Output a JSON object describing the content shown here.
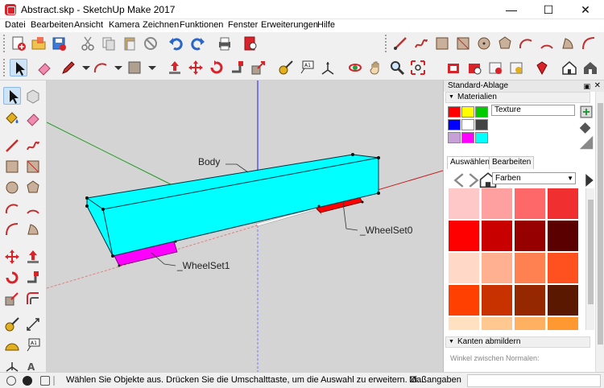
{
  "window": {
    "title": "Abstract.skp - SketchUp Make 2017",
    "controls": {
      "minimize": "—",
      "maximize": "☐",
      "close": "✕"
    }
  },
  "menu": [
    {
      "label": "Datei"
    },
    {
      "label": "Bearbeiten"
    },
    {
      "label": "Ansicht"
    },
    {
      "label": "Kamera"
    },
    {
      "label": "Zeichnen"
    },
    {
      "label": "Funktionen"
    },
    {
      "label": "Fenster"
    },
    {
      "label": "Erweiterungen"
    },
    {
      "label": "Hilfe"
    }
  ],
  "toolbar_icons": [
    "new-model-icon",
    "open-folder-icon",
    "save-icon",
    "cut-icon",
    "copy-icon",
    "paste-icon",
    "erase-icon",
    "undo-icon",
    "redo-icon",
    "print-icon",
    "model-info-icon",
    "line-icon",
    "freehand-icon",
    "rectangle-icon",
    "rotated-rectangle-icon",
    "circle-icon",
    "polygon-icon",
    "arc-icon",
    "pie-icon",
    "select-icon",
    "eraser-icon",
    "pencil-icon",
    "arc-tool-icon",
    "shape-icon",
    "push-pull-icon",
    "move-icon",
    "rotate-icon",
    "follow-me-icon",
    "scale-icon",
    "offset-icon",
    "tape-measure-icon",
    "text-icon",
    "axes-icon",
    "dimension-icon",
    "orbit-icon",
    "pan-icon",
    "zoom-icon",
    "zoom-extents-icon",
    "warehouse-icon",
    "extension-warehouse-icon",
    "layout-icon",
    "styles-icon",
    "ruby-icon",
    "home-icon",
    "house-icon"
  ],
  "scene": {
    "labels": {
      "body": "Body",
      "wheelset0": "_WheelSet0",
      "wheelset1": "_WheelSet1"
    },
    "colors": {
      "body": "#00ffff",
      "wheelset0": "#ff0000",
      "wheelset1": "#ff00ff",
      "background": "#d4d4d4"
    }
  },
  "panel": {
    "title": "Standard-Ablage",
    "pin": "▣",
    "close": "✕",
    "materials_header": "Materialien",
    "texture_field": "Texture",
    "tabs": {
      "select": "Auswählen",
      "edit": "Bearbeiten"
    },
    "collection": "Farben",
    "mini_swatches": [
      "#ff0000",
      "#ffff00",
      "#00cc00",
      "#0000ff",
      "#ffffff",
      "#444444",
      "#c8a0d8",
      "#ff00ff",
      "#00ffff"
    ],
    "swatches": [
      "#ffc8c8",
      "#ffa0a0",
      "#ff6868",
      "#f03030",
      "#ff0000",
      "#c80000",
      "#960000",
      "#5a0000",
      "#ffd8c8",
      "#ffb090",
      "#ff8050",
      "#ff5020",
      "#ff4000",
      "#c83200",
      "#962800",
      "#5a1800",
      "#ffe0c0",
      "#ffc890",
      "#ffb060",
      "#ff9830"
    ],
    "edges_header": "Kanten abmildern",
    "edges_hint": "Winkel zwischen Normalen:"
  },
  "status": {
    "text": "Wählen Sie Objekte aus. Drücken Sie die Umschalttaste, um die Auswahl zu erweitern. Zi...",
    "measure_label": "Maßangaben"
  }
}
